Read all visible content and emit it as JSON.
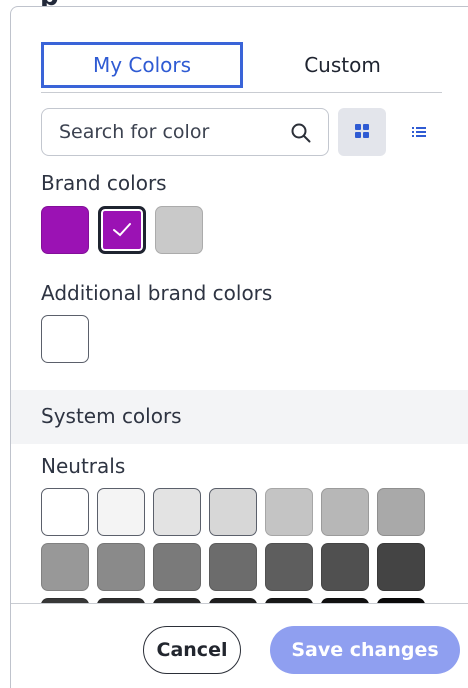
{
  "header": {
    "fragment": "p"
  },
  "tabs": [
    {
      "label": "My Colors",
      "active": true
    },
    {
      "label": "Custom",
      "active": false
    }
  ],
  "search": {
    "placeholder": "Search for color",
    "value": "",
    "icon": "search-icon"
  },
  "view_toggle": {
    "grid": {
      "icon": "grid-view-icon",
      "selected": true
    },
    "list": {
      "icon": "list-view-icon",
      "selected": false
    }
  },
  "brand": {
    "label": "Brand colors",
    "swatches": [
      {
        "color": "#9b12b4",
        "selected": false
      },
      {
        "color": "#9b12b4",
        "selected": true
      },
      {
        "color": "#c9c9c9",
        "selected": false
      }
    ]
  },
  "additional": {
    "label": "Additional brand colors",
    "swatches": [
      {
        "color": "#ffffff",
        "selected": false
      }
    ]
  },
  "system": {
    "label": "System colors"
  },
  "neutrals": {
    "label": "Neutrals",
    "rows": [
      [
        "#ffffff",
        "#f4f4f4",
        "#e3e3e3",
        "#d7d7d7",
        "#c4c4c4",
        "#b7b7b7",
        "#a9a9a9"
      ],
      [
        "#989898",
        "#8a8a8a",
        "#7a7a7a",
        "#6c6c6c",
        "#5e5e5e",
        "#505050",
        "#444444"
      ],
      [
        "#383838",
        "#2e2e2e",
        "#262626",
        "#1f1f1f",
        "#181818",
        "#111111",
        "#0a0a0a"
      ]
    ]
  },
  "footer": {
    "cancel_label": "Cancel",
    "save_label": "Save changes"
  },
  "colors": {
    "accent": "#3a64d8",
    "save_button": "#8f9ff0",
    "brand_purple": "#9b12b4",
    "border": "#c3c7cf"
  }
}
